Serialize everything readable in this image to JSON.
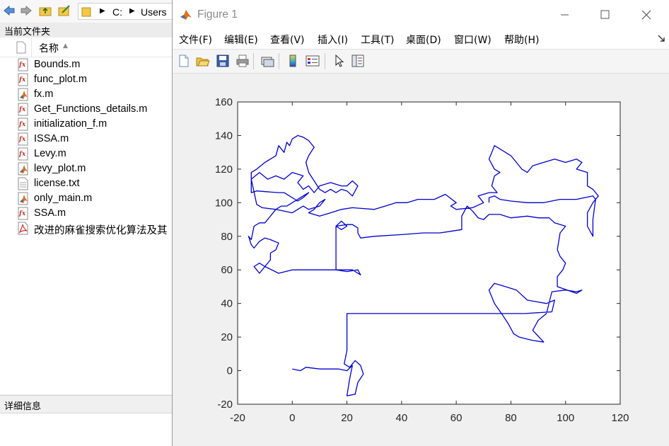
{
  "explorer": {
    "address": [
      "C:",
      "Users"
    ],
    "current_folder_title": "当前文件夹",
    "column_name": "名称",
    "files": [
      {
        "name": "Bounds.m",
        "icon": "function-file-icon"
      },
      {
        "name": "func_plot.m",
        "icon": "function-file-icon"
      },
      {
        "name": "fx.m",
        "icon": "script-file-icon"
      },
      {
        "name": "Get_Functions_details.m",
        "icon": "function-file-icon"
      },
      {
        "name": "initialization_f.m",
        "icon": "function-file-icon"
      },
      {
        "name": "ISSA.m",
        "icon": "function-file-icon"
      },
      {
        "name": "Levy.m",
        "icon": "function-file-icon"
      },
      {
        "name": "levy_plot.m",
        "icon": "script-file-icon"
      },
      {
        "name": "license.txt",
        "icon": "text-file-icon"
      },
      {
        "name": "only_main.m",
        "icon": "script-file-icon"
      },
      {
        "name": "SSA.m",
        "icon": "function-file-icon"
      },
      {
        "name": "改进的麻雀搜索优化算法及其",
        "icon": "pdf-file-icon"
      }
    ],
    "details_title": "详细信息"
  },
  "figure": {
    "title": "Figure 1",
    "menus": [
      "文件(F)",
      "编辑(E)",
      "查看(V)",
      "插入(I)",
      "工具(T)",
      "桌面(D)",
      "窗口(W)",
      "帮助(H)"
    ],
    "toolbar_icons": [
      "new-figure-icon",
      "open-file-icon",
      "save-icon",
      "print-icon",
      "link-plot-icon",
      "colorbar-icon",
      "legend-icon",
      "pointer-icon",
      "property-inspector-icon"
    ],
    "accent_color": "#0000cd"
  },
  "chart_data": {
    "type": "line",
    "title": "",
    "xlabel": "",
    "ylabel": "",
    "xlim": [
      -20,
      120
    ],
    "ylim": [
      -20,
      160
    ],
    "xticks": [
      -20,
      0,
      20,
      40,
      60,
      80,
      100,
      120
    ],
    "yticks": [
      -20,
      0,
      20,
      40,
      60,
      80,
      100,
      120,
      140,
      160
    ],
    "grid": false,
    "series": [
      {
        "color": "#0000cd",
        "points": [
          [
            0,
            1
          ],
          [
            3,
            0
          ],
          [
            5,
            2
          ],
          [
            10,
            1
          ],
          [
            17,
            1
          ],
          [
            20,
            0
          ],
          [
            22,
            3
          ],
          [
            21,
            -5
          ],
          [
            20,
            -15
          ],
          [
            23,
            -14
          ],
          [
            24,
            -7
          ],
          [
            26,
            -2
          ],
          [
            25,
            3
          ],
          [
            23,
            6
          ],
          [
            21,
            2
          ],
          [
            19,
            4
          ],
          [
            20,
            12
          ],
          [
            20,
            20
          ],
          [
            20,
            34
          ],
          [
            40,
            34
          ],
          [
            60,
            34
          ],
          [
            78,
            34
          ],
          [
            85,
            34
          ],
          [
            95,
            35
          ],
          [
            96,
            42
          ],
          [
            93,
            40
          ],
          [
            86,
            42
          ],
          [
            82,
            48
          ],
          [
            78,
            50
          ],
          [
            74,
            52
          ],
          [
            72,
            48
          ],
          [
            74,
            40
          ],
          [
            77,
            33
          ],
          [
            79,
            28
          ],
          [
            81,
            22
          ],
          [
            83,
            20
          ],
          [
            88,
            18
          ],
          [
            92,
            17
          ],
          [
            88,
            24
          ],
          [
            90,
            30
          ],
          [
            93,
            34
          ],
          [
            95,
            47
          ],
          [
            100,
            48
          ],
          [
            104,
            47
          ],
          [
            106,
            48
          ],
          [
            104,
            46
          ],
          [
            97,
            50
          ],
          [
            97,
            56
          ],
          [
            99,
            60
          ],
          [
            100,
            64
          ],
          [
            98,
            68
          ],
          [
            97,
            72
          ],
          [
            98,
            82
          ],
          [
            100,
            86
          ],
          [
            96,
            88
          ],
          [
            94,
            91
          ],
          [
            90,
            91
          ],
          [
            86,
            92
          ],
          [
            80,
            91
          ],
          [
            76,
            93
          ],
          [
            72,
            93
          ],
          [
            70,
            90
          ],
          [
            68,
            91
          ],
          [
            66,
            95
          ],
          [
            64,
            98
          ],
          [
            62,
            92
          ],
          [
            62,
            84
          ],
          [
            58,
            83
          ],
          [
            54,
            82
          ],
          [
            48,
            82
          ],
          [
            40,
            81
          ],
          [
            30,
            80
          ],
          [
            25,
            79
          ],
          [
            24,
            82
          ],
          [
            24,
            85
          ],
          [
            22,
            87
          ],
          [
            20,
            87
          ],
          [
            16,
            86
          ],
          [
            18,
            84
          ],
          [
            20,
            86
          ],
          [
            18,
            89
          ],
          [
            16,
            86
          ],
          [
            16,
            75
          ],
          [
            16,
            62
          ],
          [
            16,
            60
          ],
          [
            22,
            60
          ],
          [
            25,
            57
          ],
          [
            24,
            60
          ],
          [
            20,
            59
          ],
          [
            16,
            60
          ],
          [
            12,
            60
          ],
          [
            8,
            60
          ],
          [
            0,
            60
          ],
          [
            -5,
            58
          ],
          [
            -10,
            62
          ],
          [
            -12,
            58
          ],
          [
            -13,
            60
          ],
          [
            -14,
            62
          ],
          [
            -12,
            64
          ],
          [
            -10,
            62
          ],
          [
            -8,
            66
          ],
          [
            -8,
            70
          ],
          [
            -6,
            72
          ],
          [
            -5,
            76
          ],
          [
            -8,
            78
          ],
          [
            -10,
            79
          ],
          [
            -12,
            77
          ],
          [
            -14,
            73
          ],
          [
            -15,
            75
          ],
          [
            -16,
            80
          ],
          [
            -15,
            78
          ],
          [
            -14,
            86
          ],
          [
            -12,
            88
          ],
          [
            -10,
            88
          ],
          [
            -8,
            92
          ],
          [
            -6,
            96
          ],
          [
            -4,
            98
          ],
          [
            -2,
            98
          ],
          [
            0,
            100
          ],
          [
            2,
            102
          ],
          [
            4,
            104
          ],
          [
            6,
            106
          ],
          [
            4,
            103
          ],
          [
            2,
            101
          ],
          [
            -1,
            104
          ],
          [
            -3,
            106
          ],
          [
            -5,
            106
          ],
          [
            -13,
            107
          ],
          [
            -15,
            106
          ],
          [
            -15,
            118
          ],
          [
            -13,
            120
          ],
          [
            -10,
            124
          ],
          [
            -8,
            126
          ],
          [
            -6,
            128
          ],
          [
            -5,
            134
          ],
          [
            -3,
            130
          ],
          [
            -2,
            136
          ],
          [
            -1,
            134
          ],
          [
            0,
            138
          ],
          [
            2,
            140
          ],
          [
            4,
            139
          ],
          [
            6,
            137
          ],
          [
            8,
            133
          ],
          [
            6,
            128
          ],
          [
            5,
            124
          ],
          [
            6,
            118
          ],
          [
            8,
            113
          ],
          [
            10,
            108
          ],
          [
            12,
            106
          ],
          [
            14,
            108
          ],
          [
            16,
            106
          ],
          [
            18,
            108
          ],
          [
            20,
            107
          ],
          [
            22,
            104
          ],
          [
            24,
            110
          ],
          [
            22,
            113
          ],
          [
            20,
            110
          ],
          [
            18,
            110
          ],
          [
            14,
            112
          ],
          [
            10,
            110
          ],
          [
            8,
            106
          ],
          [
            6,
            110
          ],
          [
            4,
            108
          ],
          [
            2,
            112
          ],
          [
            4,
            116
          ],
          [
            0,
            118
          ],
          [
            -3,
            114
          ],
          [
            -6,
            116
          ],
          [
            -9,
            114
          ],
          [
            -12,
            118
          ],
          [
            -15,
            114
          ],
          [
            -13,
            99
          ],
          [
            -11,
            97
          ],
          [
            -6,
            96
          ],
          [
            0,
            94
          ],
          [
            2,
            96
          ],
          [
            4,
            98
          ],
          [
            6,
            96
          ],
          [
            10,
            98
          ],
          [
            12,
            102
          ],
          [
            10,
            100
          ],
          [
            8,
            96
          ],
          [
            6,
            94
          ],
          [
            10,
            92
          ],
          [
            14,
            94
          ],
          [
            18,
            96
          ],
          [
            22,
            97
          ],
          [
            30,
            96
          ],
          [
            34,
            98
          ],
          [
            38,
            100
          ],
          [
            42,
            100
          ],
          [
            46,
            102
          ],
          [
            52,
            102
          ],
          [
            56,
            105
          ],
          [
            60,
            100
          ],
          [
            58,
            98
          ],
          [
            60,
            96
          ],
          [
            66,
            97
          ],
          [
            70,
            100
          ],
          [
            68,
            104
          ],
          [
            72,
            106
          ],
          [
            75,
            106
          ],
          [
            73,
            110
          ],
          [
            74,
            116
          ],
          [
            76,
            118
          ],
          [
            74,
            120
          ],
          [
            72,
            126
          ],
          [
            73,
            130
          ],
          [
            74,
            134
          ],
          [
            76,
            132
          ],
          [
            80,
            128
          ],
          [
            82,
            124
          ],
          [
            84,
            120
          ],
          [
            86,
            118
          ],
          [
            88,
            122
          ],
          [
            92,
            124
          ],
          [
            96,
            126
          ],
          [
            100,
            124
          ],
          [
            104,
            126
          ],
          [
            106,
            124
          ],
          [
            104,
            120
          ],
          [
            108,
            118
          ],
          [
            108,
            110
          ],
          [
            110,
            108
          ],
          [
            112,
            104
          ],
          [
            110,
            100
          ],
          [
            108,
            94
          ],
          [
            108,
            86
          ],
          [
            110,
            80
          ],
          [
            110,
            90
          ],
          [
            111,
            102
          ],
          [
            110,
            104
          ],
          [
            104,
            102
          ],
          [
            98,
            102
          ],
          [
            92,
            100
          ],
          [
            86,
            100
          ],
          [
            80,
            101
          ],
          [
            76,
            102
          ],
          [
            74,
            104
          ],
          [
            72,
            103
          ],
          [
            72,
            100
          ]
        ]
      }
    ]
  }
}
